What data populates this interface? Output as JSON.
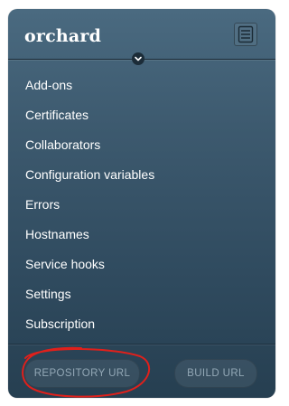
{
  "app": {
    "name": "orchard",
    "menu_icon": "hamburger-list-icon",
    "expand_icon": "chevron-down-icon"
  },
  "nav": {
    "items": [
      {
        "label": "Add-ons"
      },
      {
        "label": "Certificates"
      },
      {
        "label": "Collaborators"
      },
      {
        "label": "Configuration variables"
      },
      {
        "label": "Errors"
      },
      {
        "label": "Hostnames"
      },
      {
        "label": "Service hooks"
      },
      {
        "label": "Settings"
      },
      {
        "label": "Subscription"
      }
    ]
  },
  "footer": {
    "repository_url_label": "REPOSITORY URL",
    "build_url_label": "BUILD URL"
  },
  "colors": {
    "panel_top": "#4a6a80",
    "panel_bottom": "#263f51",
    "button_text": "#93a8b6",
    "annotation_red": "#e0201b"
  }
}
